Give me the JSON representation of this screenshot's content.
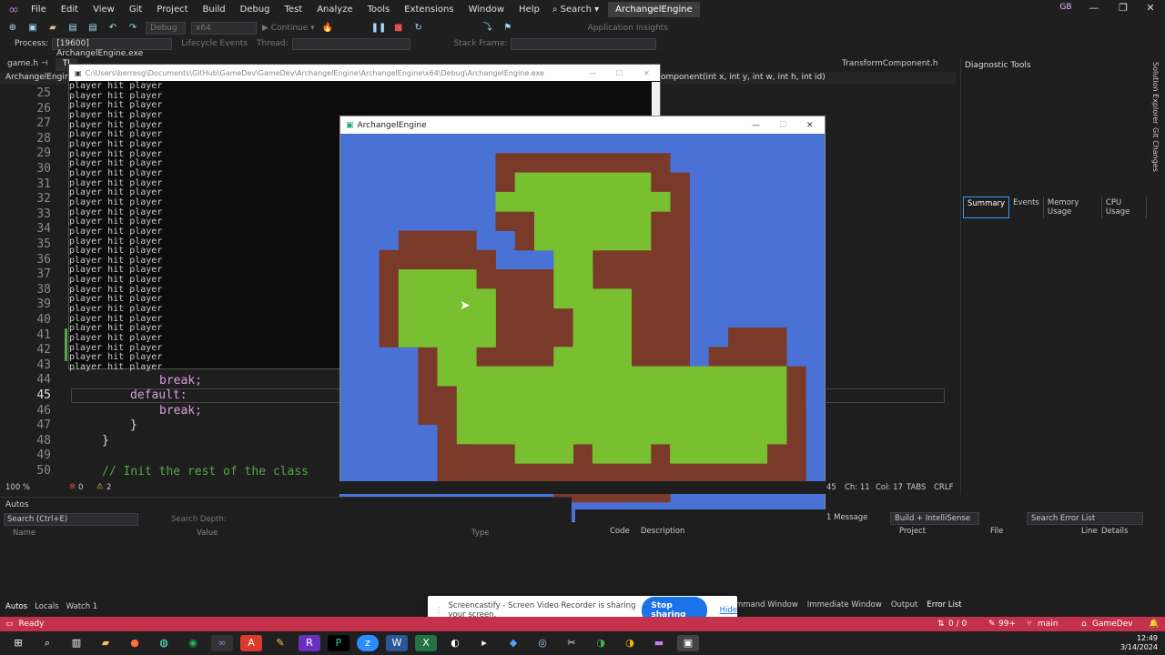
{
  "menubar": {
    "items": [
      "File",
      "Edit",
      "View",
      "Git",
      "Project",
      "Build",
      "Debug",
      "Test",
      "Analyze",
      "Tools",
      "Extensions",
      "Window",
      "Help"
    ],
    "search_label": "Search",
    "solution_name": "ArchangelEngine",
    "user_initials": "GB"
  },
  "toolbar": {
    "config": "Debug",
    "platform": "x64",
    "continue_label": "Continue",
    "app_insights": "Application Insights"
  },
  "procbar": {
    "process_label": "Process:",
    "process_value": "[19600] ArchangelEngine.exe",
    "lifecycle_label": "Lifecycle Events",
    "thread_label": "Thread:",
    "stackframe_label": "Stack Frame:"
  },
  "tabs": {
    "items": [
      "game.h",
      "TI"
    ],
    "right_tab": "TransformComponent.h"
  },
  "navbar": {
    "left": "ArchangelEngine",
    "right": "omponent(int x, int y, int w, int h, int id)"
  },
  "editor": {
    "line_numbers": [
      "25",
      "26",
      "27",
      "28",
      "29",
      "30",
      "31",
      "32",
      "33",
      "34",
      "35",
      "36",
      "37",
      "38",
      "39",
      "40",
      "41",
      "42",
      "43",
      "44",
      "45",
      "46",
      "47",
      "48",
      "49",
      "50"
    ],
    "code": {
      "l44": "break;",
      "l45": "default:",
      "l46": "break;",
      "l47": "}",
      "l48": "}",
      "l50": "// Init the rest of the class"
    }
  },
  "console": {
    "title": "C:\\Users\\berresg\\Documents\\GitHub\\GameDev\\GameDev\\ArchangelEngine\\ArchangelEngine\\x64\\Debug\\ArchangelEngine.exe",
    "lines": [
      "player hit player",
      "player hit player",
      "player hit player",
      "player hit player",
      "player hit player",
      "player hit player",
      "player hit player",
      "player hit player",
      "player hit player",
      "player hit player",
      "player hit player",
      "player hit player",
      "player hit player",
      "player hit player",
      "player hit player",
      "player hit player",
      "player hit player",
      "player hit player",
      "player hit player",
      "player hit player",
      "player hit player",
      "player hit player",
      "player hit player",
      "player hit player",
      "player hit player",
      "player hit player",
      "player hit player",
      "player hit player",
      "player hit player",
      "player hit player"
    ]
  },
  "game": {
    "title": "ArchangelEngine",
    "colors": {
      "water": "#4a72d6",
      "dirt": "#7a3a2a",
      "grass": "#78c030"
    }
  },
  "diagnostic": {
    "title": "Diagnostic Tools",
    "tabs": [
      "Summary",
      "Events",
      "Memory Usage",
      "CPU Usage"
    ],
    "rail": [
      "Solution Explorer",
      "Git Changes"
    ]
  },
  "edstatus": {
    "zoom": "100 %",
    "errors": "0",
    "warnings": "2",
    "col": "45",
    "ch": "Ch: 11",
    "col2": "Col: 17",
    "tabs": "TABS",
    "eol": "CRLF"
  },
  "autos": {
    "title": "Autos",
    "search_placeholder": "Search (Ctrl+E)",
    "search_depth": "Search Depth:",
    "columns": [
      "Name",
      "Value",
      "Type"
    ],
    "bottom_tabs": [
      "Autos",
      "Locals",
      "Watch 1"
    ]
  },
  "errors": {
    "message_count": "1 Message",
    "build_filter": "Build + IntelliSense",
    "search_placeholder": "Search Error List",
    "columns": [
      "Code",
      "Description",
      "Project",
      "File",
      "Line",
      "Details"
    ],
    "bottom_tabs": [
      "mmand Window",
      "Immediate Window",
      "Output",
      "Error List"
    ]
  },
  "sharebar": {
    "text": "Screencastify - Screen Video Recorder is sharing your screen.",
    "stop": "Stop sharing",
    "hide": "Hide"
  },
  "status": {
    "ready": "Ready",
    "git_counts": "0 / 0",
    "pencil_count": "99+",
    "branch": "main",
    "repo": "GameDev"
  },
  "taskbar": {
    "time": "12:49",
    "date": "3/14/2024"
  }
}
